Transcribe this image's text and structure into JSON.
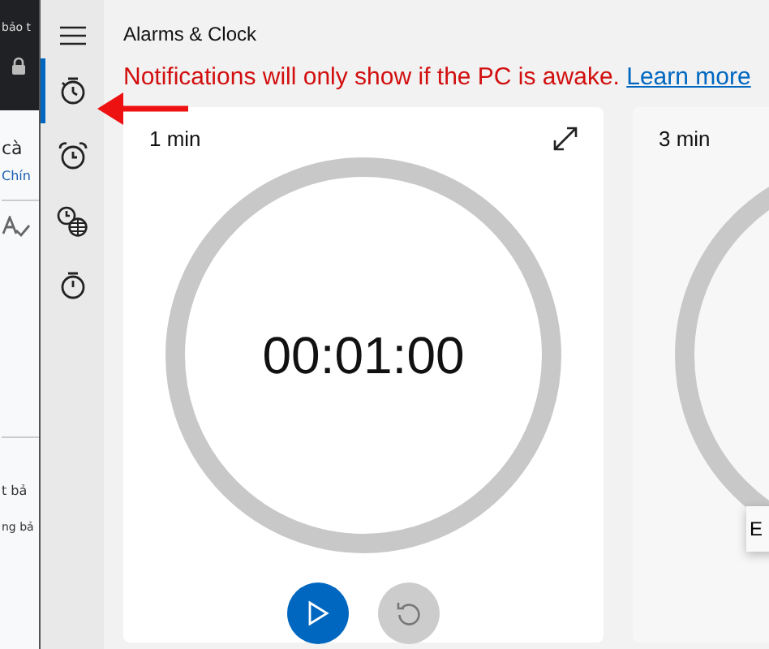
{
  "browser": {
    "tab_title": "bảo t",
    "lines_top": [
      "cà",
      "Chín"
    ],
    "lines_bottom": [
      "t bả",
      "ng bả"
    ]
  },
  "app": {
    "title": "Alarms & Clock",
    "nav": [
      {
        "kind": "menu",
        "selected": false
      },
      {
        "kind": "timer",
        "selected": true
      },
      {
        "kind": "alarm",
        "selected": false
      },
      {
        "kind": "world",
        "selected": false
      },
      {
        "kind": "stopwatch",
        "selected": false
      }
    ],
    "notice": {
      "text": "Notifications will only show if the PC is awake.",
      "link": "Learn more"
    },
    "timers": [
      {
        "name": "1 min",
        "time": "00:01:00",
        "expandable": true,
        "controls": true
      },
      {
        "name": "3 min"
      }
    ],
    "tooltip": "E"
  }
}
